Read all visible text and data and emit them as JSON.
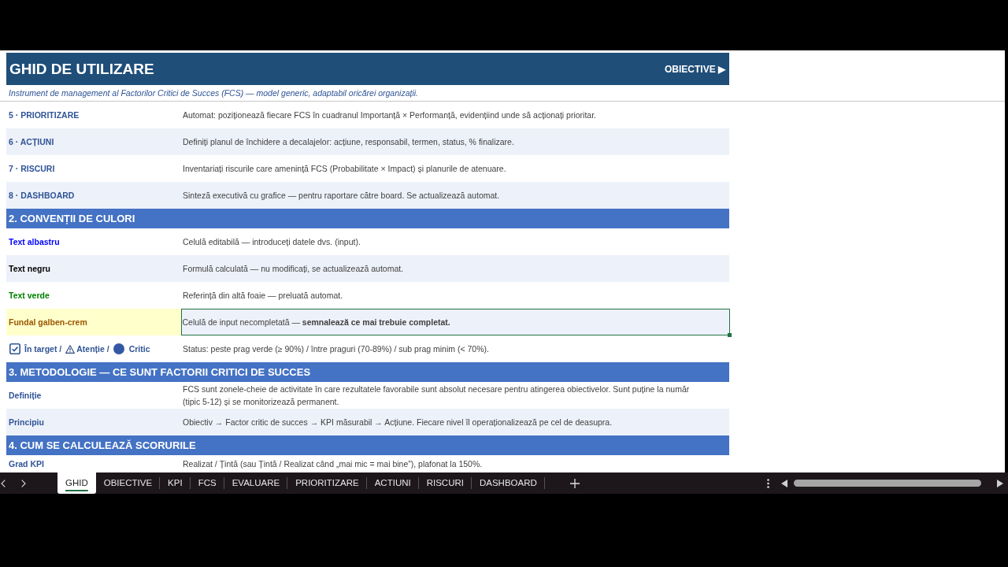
{
  "header": {
    "title": "GHID DE UTILIZARE",
    "next_link": "OBIECTIVE ▶"
  },
  "subtitle": "Instrument de management al Factorilor Critici de Succes (FCS) — model generic, adaptabil oricărei organizații.",
  "top_rows": [
    {
      "kind": "term",
      "label": "5 · PRIORITIZARE",
      "text": "Automat: poziționează fiecare FCS în cuadranul Importanță × Performanță, evidențiind unde să acționați prioritar.",
      "selected": false
    },
    {
      "kind": "term",
      "label": "6 · ACȚIUNI",
      "text": "Definiți planul de închidere a decalajelor: acțiune, responsabil, termen, status, % finalizare.",
      "selected": false
    },
    {
      "kind": "term",
      "label": "7 · RISCURI",
      "text": "Inventariați riscurile care amenință FCS (Probabilitate × Impact) și planurile de atenuare.",
      "selected": false
    },
    {
      "kind": "term",
      "label": "8 · DASHBOARD",
      "text": "Sinteză executivă cu grafice — pentru raportare către board. Se actualizează automat.",
      "selected": false
    }
  ],
  "sections": [
    {
      "title": "2. CONVENȚII DE CULORI",
      "rows": [
        {
          "kind": "color",
          "label": "Text albastru",
          "color": "#0000ff",
          "highlighted": false,
          "text": "Celulă editabilă — introduceți datele dvs. (input).",
          "selected": false
        },
        {
          "kind": "color",
          "label": "Text negru",
          "color": "#000000",
          "highlighted": false,
          "text": "Formulă calculată — nu modificați, se actualizează automat.",
          "selected": false
        },
        {
          "kind": "color",
          "label": "Text verde",
          "color": "#008000",
          "highlighted": false,
          "text": "Referință din altă foaie — preluată automat.",
          "selected": false
        },
        {
          "kind": "color",
          "label": "Fundal galben-crem",
          "color": "#9c5700",
          "highlighted": true,
          "text": "Celulă de input necompletată — **semnalează ce mai trebuie completat.**",
          "selected": true
        },
        {
          "kind": "legend",
          "legend": [
            {
              "kind": "check",
              "label": "În target /"
            },
            {
              "kind": "warning",
              "label": "Atenție /"
            },
            {
              "kind": "dot",
              "label": "Critic"
            }
          ],
          "text": "Status: peste prag verde (≥ 90%) / între praguri (70-89%) / sub prag minim (< 70%).",
          "selected": false
        }
      ]
    },
    {
      "title": "3. METODOLOGIE — CE SUNT FACTORII CRITICI DE SUCCES",
      "rows": [
        {
          "kind": "term",
          "label": "Definiție",
          "text": "FCS sunt zonele-cheie de activitate în care rezultatele favorabile sunt absolut necesare pentru atingerea obiectivelor. Sunt puține la număr (tipic 5-12) și se monitorizează permanent.",
          "selected": false
        },
        {
          "kind": "term",
          "label": "Principiu",
          "text": "Obiectiv → Factor critic de succes → KPI măsurabil → Acțiune. Fiecare nivel îl operaționalizează pe cel de deasupra.",
          "selected": false
        }
      ]
    },
    {
      "title": "4. CUM SE CALCULEAZĂ SCORURILE",
      "rows": [
        {
          "kind": "term",
          "label": "Grad KPI",
          "text": "Realizat / Țintă (sau Țintă / Realizat când „mai mic = mai bine”), plafonat la 150%.",
          "selected": false
        }
      ]
    }
  ],
  "sheet_tabs": [
    {
      "label": "GHID",
      "selected": true
    },
    {
      "label": "OBIECTIVE",
      "selected": false
    },
    {
      "label": "KPI",
      "selected": false
    },
    {
      "label": "FCS",
      "selected": false
    },
    {
      "label": "EVALUARE",
      "selected": false
    },
    {
      "label": "PRIORITIZARE",
      "selected": false
    },
    {
      "label": "ACTIUNI",
      "selected": false
    },
    {
      "label": "RISCURI",
      "selected": false
    },
    {
      "label": "DASHBOARD",
      "selected": false
    }
  ]
}
